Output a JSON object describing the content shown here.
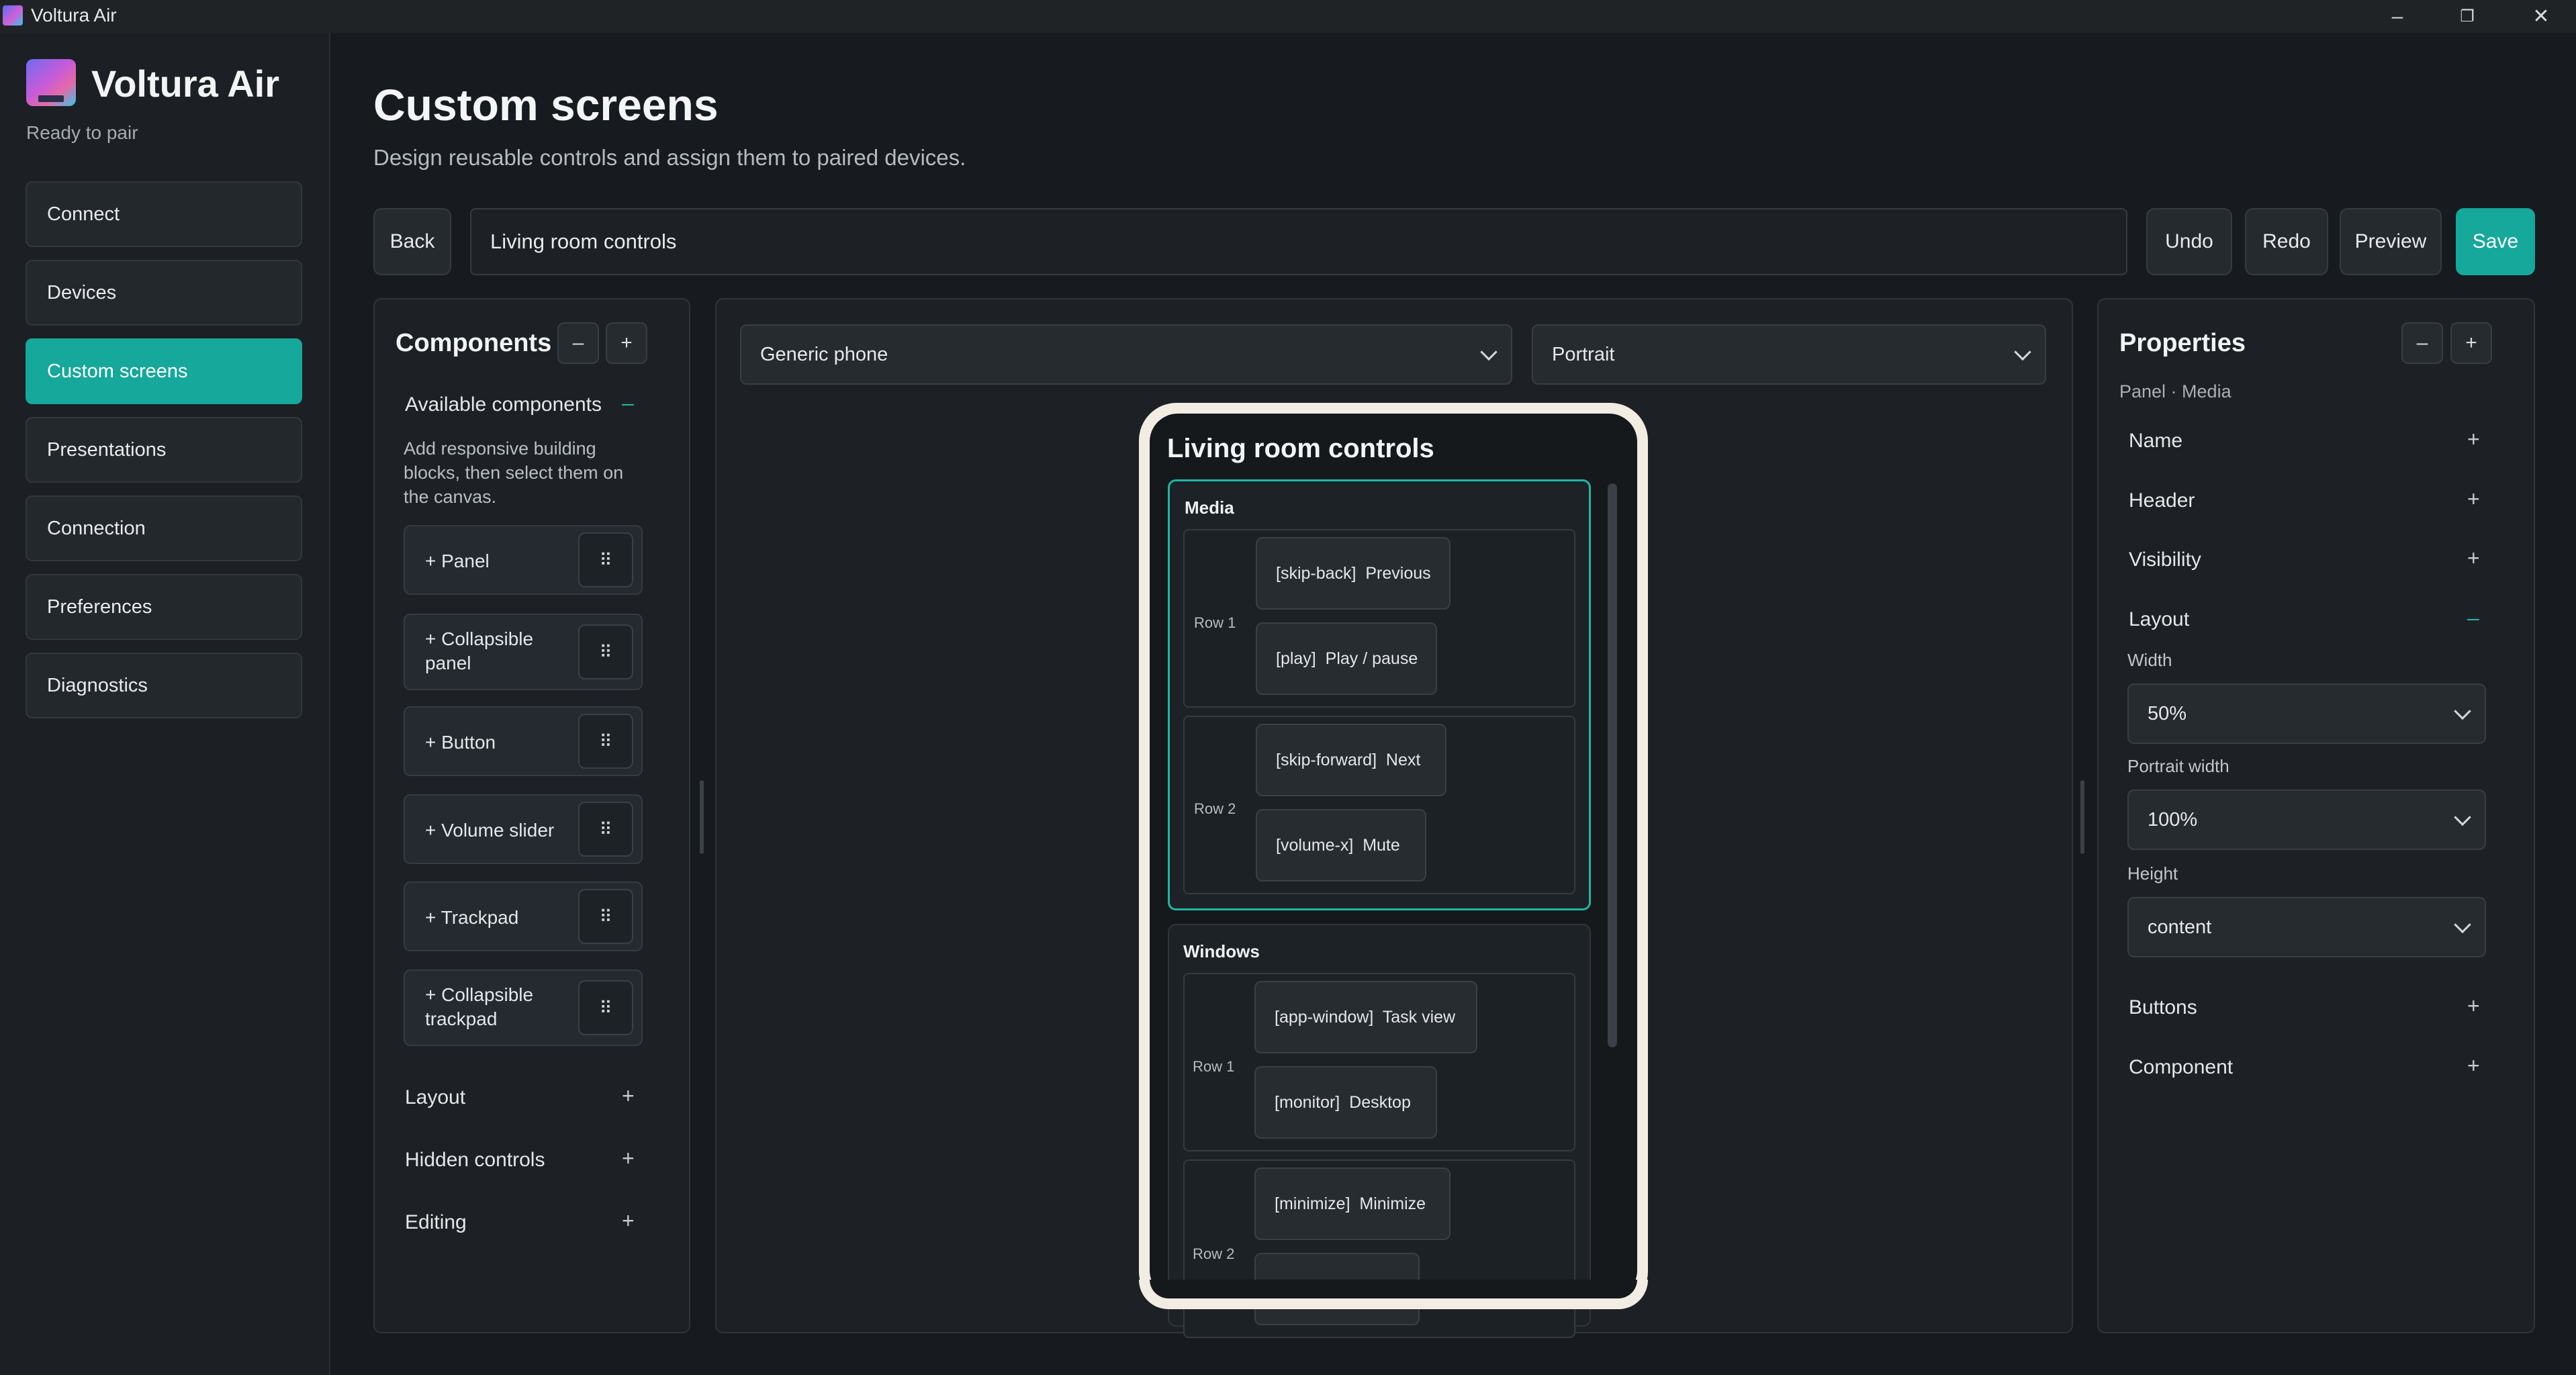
{
  "window": {
    "title": "Voltura Air",
    "controls": [
      "–",
      "❐",
      "✕"
    ]
  },
  "sidebar": {
    "app_name": "Voltura Air",
    "status": "Ready to pair",
    "items": [
      {
        "label": "Connect"
      },
      {
        "label": "Devices"
      },
      {
        "label": "Custom screens",
        "active": true
      },
      {
        "label": "Presentations"
      },
      {
        "label": "Connection"
      },
      {
        "label": "Preferences"
      },
      {
        "label": "Diagnostics"
      }
    ]
  },
  "header": {
    "title": "Custom screens",
    "subtitle": "Design reusable controls and assign them to paired devices."
  },
  "toolbar": {
    "back": "Back",
    "screen_name": "Living room controls",
    "undo": "Undo",
    "redo": "Redo",
    "preview": "Preview",
    "save": "Save"
  },
  "components": {
    "title": "Components",
    "minus": "–",
    "plus": "+",
    "available": {
      "label": "Available components",
      "toggle": "–"
    },
    "help": "Add responsive building blocks, then select them on the canvas.",
    "cards": [
      {
        "label": "+ Panel"
      },
      {
        "label": "+ Collapsible panel"
      },
      {
        "label": "+ Button"
      },
      {
        "label": "+ Volume slider"
      },
      {
        "label": "+ Trackpad"
      },
      {
        "label": "+ Collapsible trackpad"
      }
    ],
    "grip": "⠿",
    "sections": [
      {
        "label": "Layout",
        "toggle": "+"
      },
      {
        "label": "Hidden controls",
        "toggle": "+"
      },
      {
        "label": "Editing",
        "toggle": "+"
      }
    ]
  },
  "canvas": {
    "device": "Generic phone",
    "orientation": "Portrait",
    "screen_title": "Living room controls",
    "groups": [
      {
        "title": "Media",
        "rows": [
          {
            "label": "Row 1",
            "controls": [
              "[skip-back]  Previous",
              "[play]  Play / pause"
            ]
          },
          {
            "label": "Row 2",
            "controls": [
              "[skip-forward]  Next",
              "[volume-x]  Mute"
            ]
          }
        ]
      },
      {
        "title": "Windows",
        "rows": [
          {
            "label": "Row 1",
            "controls": [
              "[app-window]  Task view",
              "[monitor]  Desktop"
            ]
          },
          {
            "label": "Row 2",
            "controls": [
              "[minimize]  Minimize",
              ""
            ]
          }
        ]
      }
    ]
  },
  "properties": {
    "title": "Properties",
    "minus": "–",
    "plus": "+",
    "context": "Panel · Media",
    "sections": {
      "name": {
        "label": "Name",
        "toggle": "+"
      },
      "header": {
        "label": "Header",
        "toggle": "+"
      },
      "visibility": {
        "label": "Visibility",
        "toggle": "+"
      },
      "layout": {
        "label": "Layout",
        "toggle": "–"
      },
      "buttons": {
        "label": "Buttons",
        "toggle": "+"
      },
      "component": {
        "label": "Component",
        "toggle": "+"
      }
    },
    "fields": {
      "width": {
        "label": "Width",
        "value": "50%"
      },
      "portrait_width": {
        "label": "Portrait width",
        "value": "100%"
      },
      "height": {
        "label": "Height",
        "value": "content"
      }
    }
  },
  "colors": {
    "accent": "#16a89a",
    "background": "#171b1f"
  }
}
